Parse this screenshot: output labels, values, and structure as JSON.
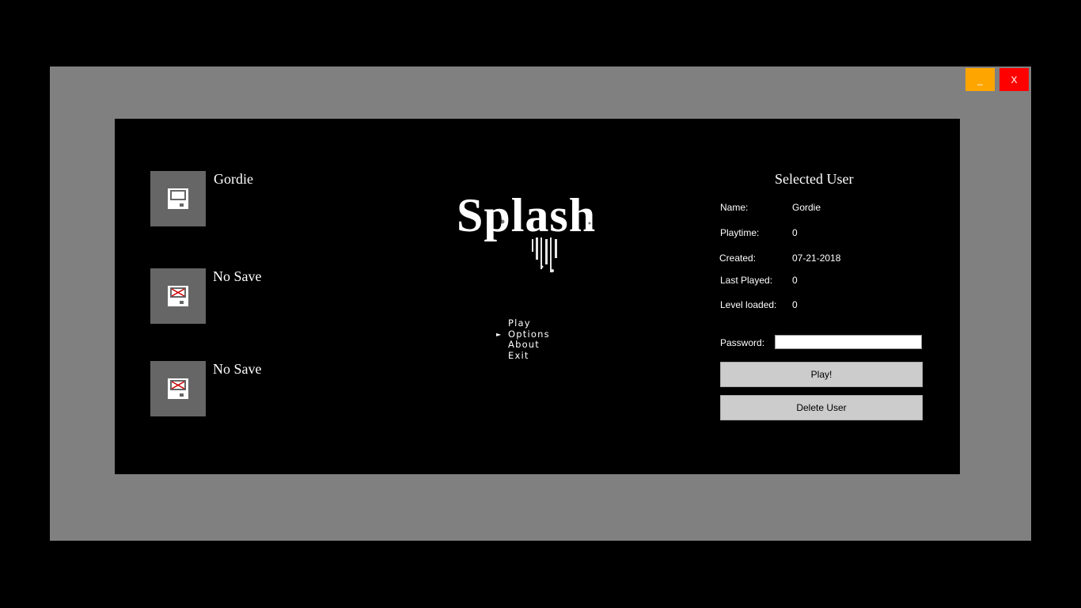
{
  "window": {
    "minimize_label": "_",
    "close_label": "X"
  },
  "save_slots": [
    {
      "name": "Gordie",
      "icon": "floppy-disk-icon"
    },
    {
      "name": "No Save",
      "icon": "floppy-disk-empty-icon"
    },
    {
      "name": "No Save",
      "icon": "floppy-disk-empty-icon"
    }
  ],
  "logo": {
    "text": "Splash"
  },
  "menu": {
    "selected_index": 1,
    "items": [
      "Play",
      "Options",
      "About",
      "Exit"
    ]
  },
  "selected_user": {
    "title": "Selected User",
    "fields": [
      {
        "label": "Name:",
        "value": "Gordie"
      },
      {
        "label": "Playtime:",
        "value": "0"
      },
      {
        "label": "Created:",
        "value": "07-21-2018"
      },
      {
        "label": "Last Played:",
        "value": "0"
      },
      {
        "label": "Level loaded:",
        "value": "0"
      }
    ],
    "password_label": "Password:",
    "password_value": "",
    "play_label": "Play!",
    "delete_label": "Delete User"
  },
  "colors": {
    "minimize": "#ffa500",
    "close": "#ff0000",
    "window_bg": "#808080",
    "button_bg": "#cccccc"
  }
}
